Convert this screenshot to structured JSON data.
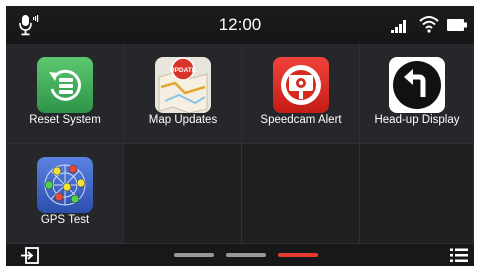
{
  "status_bar": {
    "time": "12:00",
    "icons": [
      "microphone-icon",
      "signal-icon",
      "wifi-icon",
      "battery-icon"
    ]
  },
  "apps": [
    {
      "label": "Reset System",
      "icon": "reset-system-icon",
      "color": "#3daa5a"
    },
    {
      "label": "Map Updates",
      "icon": "map-update-icon",
      "badge": "UPDATE",
      "color": "#d8342a"
    },
    {
      "label": "Speedcam Alert",
      "icon": "speedcam-icon",
      "color": "#d7281f"
    },
    {
      "label": "Head-up Display",
      "icon": "turn-left-arrow-icon",
      "color": "#111111"
    },
    {
      "label": "GPS Test",
      "icon": "gps-test-icon",
      "color": "#3b63c9"
    }
  ],
  "bottom_bar": {
    "left_icon": "exit-icon",
    "right_icon": "menu-list-icon",
    "page_count": 3,
    "active_page": 3
  },
  "colors": {
    "accent": "#e53a2e",
    "background": "#1e1f21"
  }
}
